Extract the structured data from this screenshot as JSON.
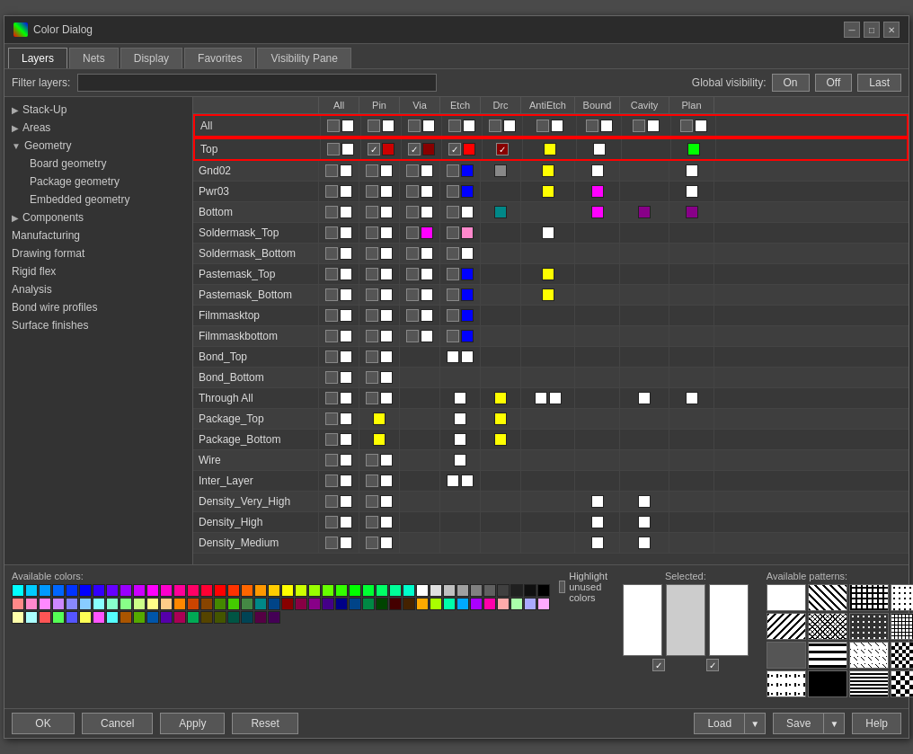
{
  "dialog": {
    "title": "Color Dialog",
    "tabs": [
      "Layers",
      "Nets",
      "Display",
      "Favorites",
      "Visibility Pane"
    ],
    "active_tab": "Layers"
  },
  "filter": {
    "label": "Filter layers:",
    "placeholder": "",
    "global_visibility_label": "Global visibility:",
    "on_label": "On",
    "off_label": "Off",
    "last_label": "Last"
  },
  "sidebar": {
    "items": [
      {
        "label": "Stack-Up",
        "level": 1,
        "has_arrow": true,
        "expanded": false
      },
      {
        "label": "Areas",
        "level": 1,
        "has_arrow": true,
        "expanded": false
      },
      {
        "label": "Geometry",
        "level": 1,
        "has_arrow": true,
        "expanded": true
      },
      {
        "label": "Board geometry",
        "level": 2,
        "has_arrow": false
      },
      {
        "label": "Package geometry",
        "level": 2,
        "has_arrow": false
      },
      {
        "label": "Embedded geometry",
        "level": 2,
        "has_arrow": false
      },
      {
        "label": "Components",
        "level": 1,
        "has_arrow": true,
        "expanded": false
      },
      {
        "label": "Manufacturing",
        "level": 1,
        "has_arrow": false
      },
      {
        "label": "Drawing format",
        "level": 1,
        "has_arrow": false
      },
      {
        "label": "Rigid flex",
        "level": 1,
        "has_arrow": false
      },
      {
        "label": "Analysis",
        "level": 1,
        "has_arrow": false
      },
      {
        "label": "Bond wire profiles",
        "level": 1,
        "has_arrow": false
      },
      {
        "label": "Surface finishes",
        "level": 1,
        "has_arrow": false
      }
    ]
  },
  "grid": {
    "columns": [
      "",
      "All",
      "Pin",
      "Via",
      "Etch",
      "Drc",
      "AntiEtch",
      "Bound",
      "Cavity",
      "Plan"
    ],
    "rows": [
      {
        "name": "All",
        "special": "all-row"
      },
      {
        "name": "Top",
        "special": "top-row"
      },
      {
        "name": "Gnd02",
        "special": ""
      },
      {
        "name": "Pwr03",
        "special": ""
      },
      {
        "name": "Bottom",
        "special": ""
      },
      {
        "name": "Soldermask_Top",
        "special": ""
      },
      {
        "name": "Soldermask_Bottom",
        "special": ""
      },
      {
        "name": "Pastemask_Top",
        "special": ""
      },
      {
        "name": "Pastemask_Bottom",
        "special": ""
      },
      {
        "name": "Filmmasktop",
        "special": ""
      },
      {
        "name": "Filmmaskbottom",
        "special": ""
      },
      {
        "name": "Bond_Top",
        "special": ""
      },
      {
        "name": "Bond_Bottom",
        "special": ""
      },
      {
        "name": "Through All",
        "special": ""
      },
      {
        "name": "Package_Top",
        "special": ""
      },
      {
        "name": "Package_Bottom",
        "special": ""
      },
      {
        "name": "Wire",
        "special": ""
      },
      {
        "name": "Inter_Layer",
        "special": ""
      },
      {
        "name": "Density_Very_High",
        "special": ""
      },
      {
        "name": "Density_High",
        "special": ""
      },
      {
        "name": "Density_Medium",
        "special": ""
      }
    ]
  },
  "bottom": {
    "available_colors_label": "Available colors:",
    "highlight_label": "Highlight unused colors",
    "selected_label": "Selected:",
    "available_patterns_label": "Available patterns:",
    "buttons": {
      "ok": "OK",
      "cancel": "Cancel",
      "apply": "Apply",
      "reset": "Reset",
      "load": "Load",
      "save": "Save",
      "help": "Help"
    }
  }
}
